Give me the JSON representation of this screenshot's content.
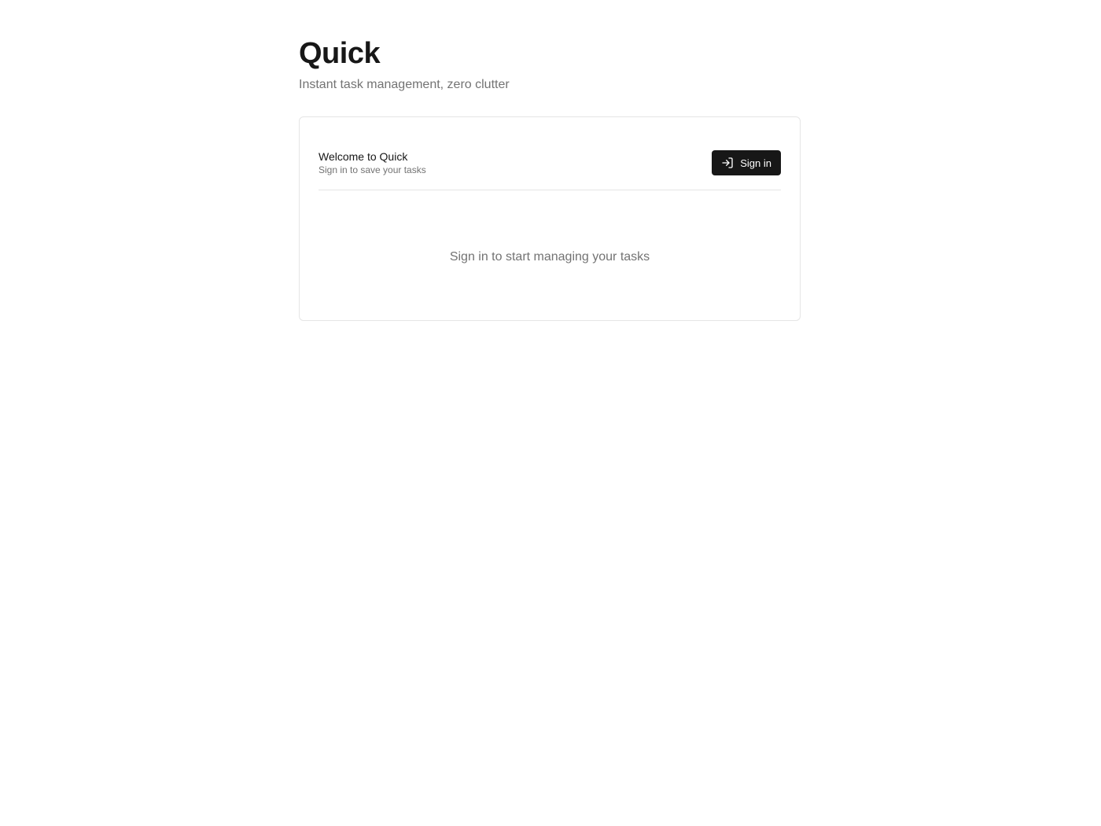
{
  "header": {
    "title": "Quick",
    "subtitle": "Instant task management, zero clutter"
  },
  "card": {
    "welcome_title": "Welcome to Quick",
    "welcome_subtitle": "Sign in to save your tasks",
    "sign_in_label": "Sign in",
    "sign_in_icon": "log-in-icon",
    "empty_message": "Sign in to start managing your tasks"
  },
  "colors": {
    "text": "#171717",
    "muted": "#737373",
    "border": "#e5e5e5",
    "button_bg": "#171717",
    "button_text": "#ffffff"
  }
}
